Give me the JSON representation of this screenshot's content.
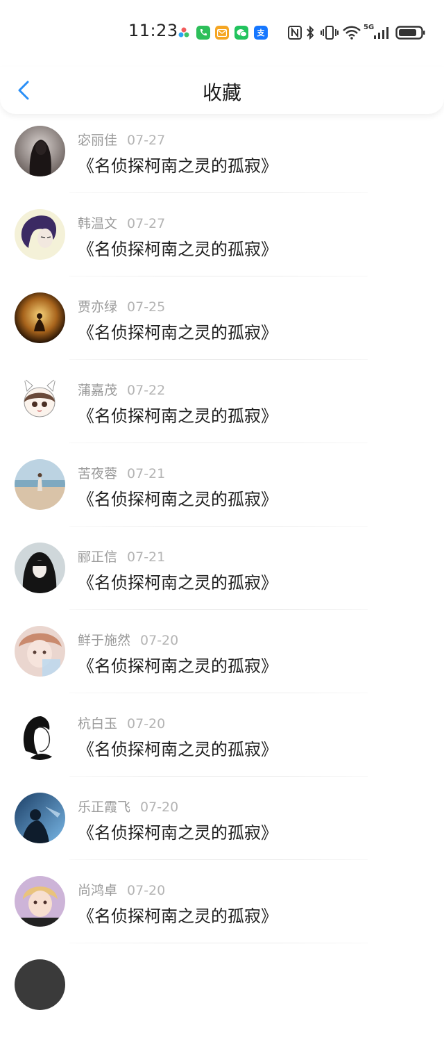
{
  "status_bar": {
    "time": "11:23",
    "network": "5G",
    "notification_icons": [
      {
        "name": "app-multicolor-icon",
        "color": "#e8e8e8",
        "glyph": "●"
      },
      {
        "name": "phone-app-icon",
        "color": "#2dbf5a",
        "glyph": "☎"
      },
      {
        "name": "mail-app-icon",
        "color": "#f5a623",
        "glyph": "✉"
      },
      {
        "name": "wechat-app-icon",
        "color": "#22c35e",
        "glyph": "◉"
      },
      {
        "name": "alipay-app-icon",
        "color": "#1677ff",
        "glyph": "支"
      }
    ]
  },
  "header": {
    "title": "收藏",
    "back_color": "#2a8ff7"
  },
  "items": [
    {
      "name": "宓丽佳",
      "date": "07-27",
      "title": "《名侦探柯南之灵的孤寂》",
      "avatar": "dark-hair"
    },
    {
      "name": "韩温文",
      "date": "07-27",
      "title": "《名侦探柯南之灵的孤寂》",
      "avatar": "purple-hair"
    },
    {
      "name": "贾亦绿",
      "date": "07-25",
      "title": "《名侦探柯南之灵的孤寂》",
      "avatar": "golden-night"
    },
    {
      "name": "蒲嘉茂",
      "date": "07-22",
      "title": "《名侦探柯南之灵的孤寂》",
      "avatar": "bunny-girl"
    },
    {
      "name": "苦夜蓉",
      "date": "07-21",
      "title": "《名侦探柯南之灵的孤寂》",
      "avatar": "beach"
    },
    {
      "name": "郦正信",
      "date": "07-21",
      "title": "《名侦探柯南之灵的孤寂》",
      "avatar": "dark-girl"
    },
    {
      "name": "鲜于施然",
      "date": "07-20",
      "title": "《名侦探柯南之灵的孤寂》",
      "avatar": "pink-portrait"
    },
    {
      "name": "杭白玉",
      "date": "07-20",
      "title": "《名侦探柯南之灵的孤寂》",
      "avatar": "sketch-woman"
    },
    {
      "name": "乐正霞飞",
      "date": "07-20",
      "title": "《名侦探柯南之灵的孤寂》",
      "avatar": "blue-scene"
    },
    {
      "name": "尚鸿卓",
      "date": "07-20",
      "title": "《名侦探柯南之灵的孤寂》",
      "avatar": "boy-portrait"
    }
  ]
}
